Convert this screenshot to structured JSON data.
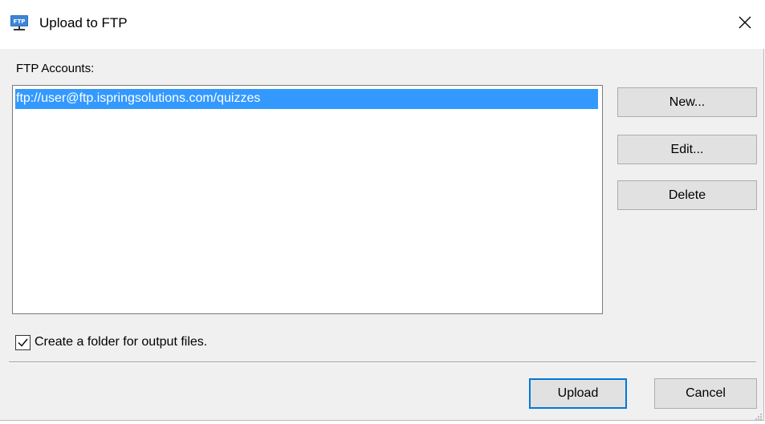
{
  "window": {
    "title": "Upload to FTP",
    "app_icon": "ftp-icon",
    "close_icon": "close-icon"
  },
  "accounts": {
    "label": "FTP Accounts:",
    "items": [
      {
        "text": "ftp://user@ftp.ispringsolutions.com/quizzes",
        "selected": true
      }
    ]
  },
  "side_buttons": {
    "new_label": "New...",
    "edit_label": "Edit...",
    "delete_label": "Delete"
  },
  "options": {
    "create_folder_label": "Create a folder for output files.",
    "create_folder_checked": true
  },
  "footer": {
    "upload_label": "Upload",
    "cancel_label": "Cancel"
  },
  "colors": {
    "selection": "#3399ff",
    "default_button_border": "#0078d7",
    "button_face": "#e1e1e1"
  }
}
